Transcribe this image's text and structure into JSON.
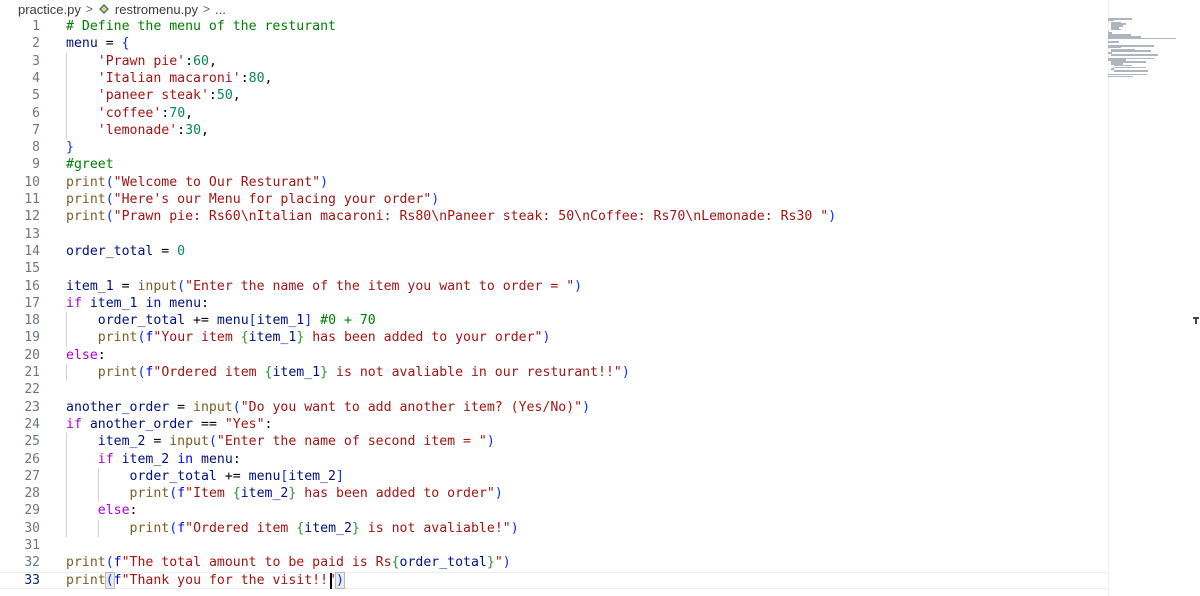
{
  "breadcrumb": {
    "file1": "practice.py",
    "sep": ">",
    "file2": "restromenu.py",
    "more": "..."
  },
  "colors": {
    "keyword_control": "#af00db",
    "builtin": "#795e26",
    "string": "#a31515",
    "comment": "#008000",
    "variable": "#001080",
    "number": "#098658",
    "keyword": "#0000ff",
    "bracket1": "#0431fa",
    "bracket2": "#319331",
    "bracket3": "#7b3814",
    "default": "#000000"
  },
  "lines": [
    {
      "n": "1",
      "tokens": [
        [
          "# Define the menu of the resturant",
          "comment"
        ]
      ]
    },
    {
      "n": "2",
      "tokens": [
        [
          "menu",
          "variable"
        ],
        [
          " = ",
          "default"
        ],
        [
          "{",
          "bracket1"
        ]
      ]
    },
    {
      "n": "3",
      "tokens": [
        [
          "    ",
          "default"
        ],
        [
          "'Prawn pie'",
          "string"
        ],
        [
          ":",
          "default"
        ],
        [
          "60",
          "number"
        ],
        [
          ",",
          "default"
        ]
      ]
    },
    {
      "n": "4",
      "tokens": [
        [
          "    ",
          "default"
        ],
        [
          "'Italian macaroni'",
          "string"
        ],
        [
          ":",
          "default"
        ],
        [
          "80",
          "number"
        ],
        [
          ",",
          "default"
        ]
      ]
    },
    {
      "n": "5",
      "tokens": [
        [
          "    ",
          "default"
        ],
        [
          "'paneer steak'",
          "string"
        ],
        [
          ":",
          "default"
        ],
        [
          "50",
          "number"
        ],
        [
          ",",
          "default"
        ]
      ]
    },
    {
      "n": "6",
      "tokens": [
        [
          "    ",
          "default"
        ],
        [
          "'coffee'",
          "string"
        ],
        [
          ":",
          "default"
        ],
        [
          "70",
          "number"
        ],
        [
          ",",
          "default"
        ]
      ]
    },
    {
      "n": "7",
      "tokens": [
        [
          "    ",
          "default"
        ],
        [
          "'lemonade'",
          "string"
        ],
        [
          ":",
          "default"
        ],
        [
          "30",
          "number"
        ],
        [
          ",",
          "default"
        ]
      ]
    },
    {
      "n": "8",
      "tokens": [
        [
          "}",
          "bracket1"
        ]
      ]
    },
    {
      "n": "9",
      "tokens": [
        [
          "#greet",
          "comment"
        ]
      ]
    },
    {
      "n": "10",
      "tokens": [
        [
          "print",
          "builtin"
        ],
        [
          "(",
          "bracket1"
        ],
        [
          "\"Welcome to Our Resturant\"",
          "string"
        ],
        [
          ")",
          "bracket1"
        ]
      ]
    },
    {
      "n": "11",
      "tokens": [
        [
          "print",
          "builtin"
        ],
        [
          "(",
          "bracket1"
        ],
        [
          "\"Here's our Menu for placing your order\"",
          "string"
        ],
        [
          ")",
          "bracket1"
        ]
      ]
    },
    {
      "n": "12",
      "tokens": [
        [
          "print",
          "builtin"
        ],
        [
          "(",
          "bracket1"
        ],
        [
          "\"Prawn pie: Rs60\\nItalian macaroni: Rs80\\nPaneer steak: 50\\nCoffee: Rs70\\nLemonade: Rs30 \"",
          "string"
        ],
        [
          ")",
          "bracket1"
        ]
      ]
    },
    {
      "n": "13",
      "tokens": []
    },
    {
      "n": "14",
      "tokens": [
        [
          "order_total",
          "variable"
        ],
        [
          " = ",
          "default"
        ],
        [
          "0",
          "number"
        ]
      ]
    },
    {
      "n": "15",
      "tokens": []
    },
    {
      "n": "16",
      "tokens": [
        [
          "item_1",
          "variable"
        ],
        [
          " = ",
          "default"
        ],
        [
          "input",
          "builtin"
        ],
        [
          "(",
          "bracket1"
        ],
        [
          "\"Enter the name of the item you want to order = \"",
          "string"
        ],
        [
          ")",
          "bracket1"
        ]
      ]
    },
    {
      "n": "17",
      "tokens": [
        [
          "if",
          "keyword_control"
        ],
        [
          " ",
          "default"
        ],
        [
          "item_1",
          "variable"
        ],
        [
          " ",
          "default"
        ],
        [
          "in",
          "keyword"
        ],
        [
          " ",
          "default"
        ],
        [
          "menu",
          "variable"
        ],
        [
          ":",
          "default"
        ]
      ]
    },
    {
      "n": "18",
      "tokens": [
        [
          "    ",
          "default"
        ],
        [
          "order_total",
          "variable"
        ],
        [
          " += ",
          "default"
        ],
        [
          "menu",
          "variable"
        ],
        [
          "[",
          "bracket1"
        ],
        [
          "item_1",
          "variable"
        ],
        [
          "]",
          "bracket1"
        ],
        [
          " ",
          "default"
        ],
        [
          "#0 + 70",
          "comment"
        ]
      ]
    },
    {
      "n": "19",
      "tokens": [
        [
          "    ",
          "default"
        ],
        [
          "print",
          "builtin"
        ],
        [
          "(",
          "bracket1"
        ],
        [
          "f",
          "keyword"
        ],
        [
          "\"Your item ",
          "string"
        ],
        [
          "{",
          "bracket2"
        ],
        [
          "item_1",
          "variable"
        ],
        [
          "}",
          "bracket2"
        ],
        [
          " has been added to your order\"",
          "string"
        ],
        [
          ")",
          "bracket1"
        ]
      ]
    },
    {
      "n": "20",
      "tokens": [
        [
          "else",
          "keyword_control"
        ],
        [
          ":",
          "default"
        ]
      ]
    },
    {
      "n": "21",
      "tokens": [
        [
          "    ",
          "default"
        ],
        [
          "print",
          "builtin"
        ],
        [
          "(",
          "bracket1"
        ],
        [
          "f",
          "keyword"
        ],
        [
          "\"Ordered item ",
          "string"
        ],
        [
          "{",
          "bracket2"
        ],
        [
          "item_1",
          "variable"
        ],
        [
          "}",
          "bracket2"
        ],
        [
          " is not avaliable in our resturant!!\"",
          "string"
        ],
        [
          ")",
          "bracket1"
        ]
      ]
    },
    {
      "n": "22",
      "tokens": []
    },
    {
      "n": "23",
      "tokens": [
        [
          "another_order",
          "variable"
        ],
        [
          " = ",
          "default"
        ],
        [
          "input",
          "builtin"
        ],
        [
          "(",
          "bracket1"
        ],
        [
          "\"Do you want to add another item? (Yes/No)\"",
          "string"
        ],
        [
          ")",
          "bracket1"
        ]
      ]
    },
    {
      "n": "24",
      "tokens": [
        [
          "if",
          "keyword_control"
        ],
        [
          " ",
          "default"
        ],
        [
          "another_order",
          "variable"
        ],
        [
          " == ",
          "default"
        ],
        [
          "\"Yes\"",
          "string"
        ],
        [
          ":",
          "default"
        ]
      ]
    },
    {
      "n": "25",
      "tokens": [
        [
          "    ",
          "default"
        ],
        [
          "item_2",
          "variable"
        ],
        [
          " = ",
          "default"
        ],
        [
          "input",
          "builtin"
        ],
        [
          "(",
          "bracket1"
        ],
        [
          "\"Enter the name of second item = \"",
          "string"
        ],
        [
          ")",
          "bracket1"
        ]
      ]
    },
    {
      "n": "26",
      "tokens": [
        [
          "    ",
          "default"
        ],
        [
          "if",
          "keyword_control"
        ],
        [
          " ",
          "default"
        ],
        [
          "item_2",
          "variable"
        ],
        [
          " ",
          "default"
        ],
        [
          "in",
          "keyword"
        ],
        [
          " ",
          "default"
        ],
        [
          "menu",
          "variable"
        ],
        [
          ":",
          "default"
        ]
      ]
    },
    {
      "n": "27",
      "tokens": [
        [
          "        ",
          "default"
        ],
        [
          "order_total",
          "variable"
        ],
        [
          " += ",
          "default"
        ],
        [
          "menu",
          "variable"
        ],
        [
          "[",
          "bracket1"
        ],
        [
          "item_2",
          "variable"
        ],
        [
          "]",
          "bracket1"
        ]
      ]
    },
    {
      "n": "28",
      "tokens": [
        [
          "        ",
          "default"
        ],
        [
          "print",
          "builtin"
        ],
        [
          "(",
          "bracket1"
        ],
        [
          "f",
          "keyword"
        ],
        [
          "\"Item ",
          "string"
        ],
        [
          "{",
          "bracket2"
        ],
        [
          "item_2",
          "variable"
        ],
        [
          "}",
          "bracket2"
        ],
        [
          " has been added to order\"",
          "string"
        ],
        [
          ")",
          "bracket1"
        ]
      ]
    },
    {
      "n": "29",
      "tokens": [
        [
          "    ",
          "default"
        ],
        [
          "else",
          "keyword_control"
        ],
        [
          ":",
          "default"
        ]
      ]
    },
    {
      "n": "30",
      "tokens": [
        [
          "        ",
          "default"
        ],
        [
          "print",
          "builtin"
        ],
        [
          "(",
          "bracket1"
        ],
        [
          "f",
          "keyword"
        ],
        [
          "\"Ordered item ",
          "string"
        ],
        [
          "{",
          "bracket2"
        ],
        [
          "item_2",
          "variable"
        ],
        [
          "}",
          "bracket2"
        ],
        [
          " is not avaliable!\"",
          "string"
        ],
        [
          ")",
          "bracket1"
        ]
      ]
    },
    {
      "n": "31",
      "tokens": []
    },
    {
      "n": "32",
      "tokens": [
        [
          "print",
          "builtin"
        ],
        [
          "(",
          "bracket1"
        ],
        [
          "f",
          "keyword"
        ],
        [
          "\"The total amount to be paid is Rs",
          "string"
        ],
        [
          "{",
          "bracket2"
        ],
        [
          "order_total",
          "variable"
        ],
        [
          "}",
          "bracket2"
        ],
        [
          "\"",
          "string"
        ],
        [
          ")",
          "bracket1"
        ]
      ]
    },
    {
      "n": "33",
      "tokens": [
        [
          "print",
          "builtin"
        ],
        [
          "(",
          "bracket1"
        ],
        [
          "f",
          "keyword"
        ],
        [
          "\"Thank you for the visit!!\"",
          "string"
        ],
        [
          ")",
          "bracket1"
        ]
      ]
    }
  ]
}
